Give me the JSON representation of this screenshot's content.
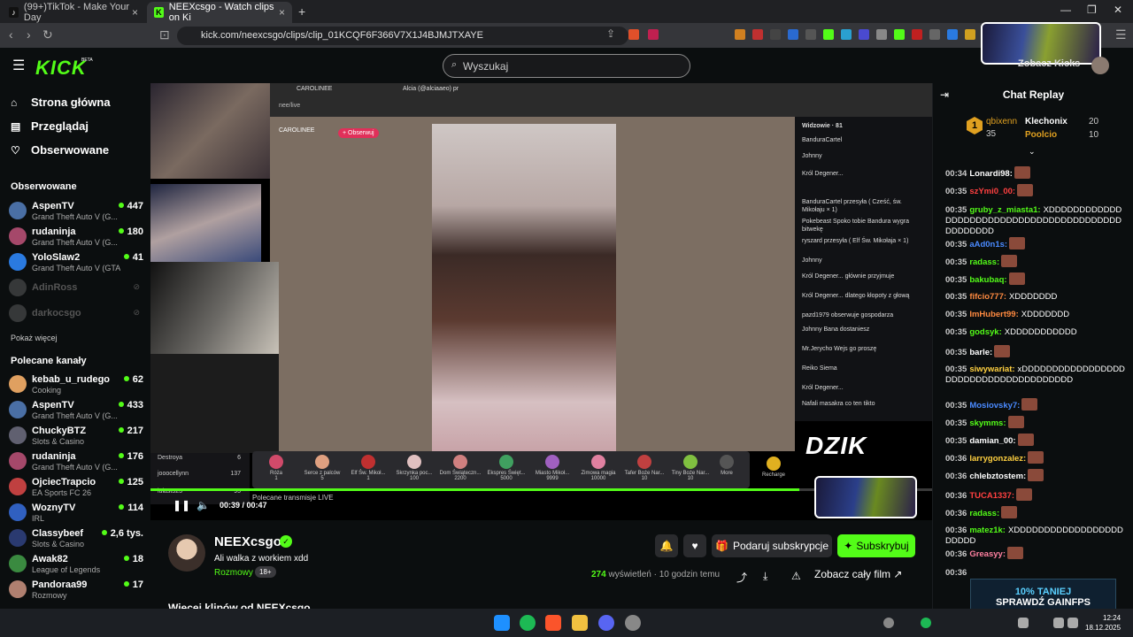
{
  "browser": {
    "tabs": [
      {
        "title": "(99+)TikTok - Make Your Day",
        "active": false
      },
      {
        "title": "NEEXcsgo - Watch clips on Ki",
        "active": true
      }
    ],
    "new_tab": "+",
    "url": "kick.com/neexcsgo/clips/clip_01KCQF6F366V7X1J4BJMJTXAYE"
  },
  "site": {
    "logo": "KICK",
    "logo_badge": "BETA",
    "search_placeholder": "Wyszukaj",
    "zobacz_label": "Zobacz Kicks"
  },
  "sidebar": {
    "nav": [
      {
        "label": "Strona główna",
        "icon": "home-icon"
      },
      {
        "label": "Przeglądaj",
        "icon": "browse-icon"
      },
      {
        "label": "Obserwowane",
        "icon": "heart-icon"
      }
    ],
    "followed_title": "Obserwowane",
    "followed": [
      {
        "name": "AspenTV",
        "game": "Grand Theft Auto V (G...",
        "viewers": "447",
        "color": "#4a6fa5",
        "live": true
      },
      {
        "name": "rudaninja",
        "game": "Grand Theft Auto V (G...",
        "viewers": "180",
        "color": "#a5486a",
        "live": true
      },
      {
        "name": "YoloSlaw2",
        "game": "Grand Theft Auto V (GTA)",
        "viewers": "41",
        "color": "#2a7ae0",
        "live": true
      },
      {
        "name": "AdinRoss",
        "game": "",
        "viewers": "",
        "color": "#777",
        "live": false
      },
      {
        "name": "darkocsgo",
        "game": "",
        "viewers": "",
        "color": "#777",
        "live": false
      }
    ],
    "show_more": "Pokaż więcej",
    "recommended_title": "Polecane kanały",
    "recommended": [
      {
        "name": "kebab_u_rudego",
        "game": "Cooking",
        "viewers": "62",
        "color": "#e0a060"
      },
      {
        "name": "AspenTV",
        "game": "Grand Theft Auto V (G...",
        "viewers": "433",
        "color": "#4a6fa5"
      },
      {
        "name": "ChuckyBTZ",
        "game": "Slots & Casino",
        "viewers": "217",
        "color": "#606070"
      },
      {
        "name": "rudaninja",
        "game": "Grand Theft Auto V (G...",
        "viewers": "176",
        "color": "#a5486a"
      },
      {
        "name": "OjciecTrapcio",
        "game": "EA Sports FC 26",
        "viewers": "125",
        "color": "#c04040"
      },
      {
        "name": "WoznyTV",
        "game": "IRL",
        "viewers": "114",
        "color": "#3060c0"
      },
      {
        "name": "Classybeef",
        "game": "Slots & Casino",
        "viewers": "2,6 tys.",
        "color": "#2a3a70"
      },
      {
        "name": "Awak82",
        "game": "League of Legends",
        "viewers": "18",
        "color": "#3a8a40"
      },
      {
        "name": "Pandoraa99",
        "game": "Rozmowy",
        "viewers": "17",
        "color": "#b08070"
      }
    ]
  },
  "player": {
    "inner_tab_1": "CAROLINEE",
    "inner_tab_2": "Alcia (@alciaaeo) pr",
    "inner_url": "nee/live",
    "stream_owner": "CAROLINEE",
    "follow_label": "+ Obserwuj",
    "viewers_header": "Widzowie · 81",
    "inner_chat": [
      "BanduraCartel",
      "Johnny",
      "Król Degener...",
      "BanduraCartel przesyła ( Cześć, św. Mikołaju × 1)",
      "Pokebeast Spoko tobie Bandura wygra bitwekę",
      "ryszard przesyła ( Elf Św. Mikołaja × 1)",
      "Johnny",
      "Król Degener... głównie przyjmuje",
      "Król Degener... dlatego kłopoty z głową",
      "pazd1979 obserwuje gospodarza",
      "Johnny Bana dostaniesz",
      "Mr.Jerycho Wejs go proszę",
      "Reiko Siema",
      "Król Degener...",
      "Nafali masakra co ten tikto"
    ],
    "gifts": [
      {
        "name": "Róża",
        "cost": "1"
      },
      {
        "name": "Serce z palców",
        "cost": "5"
      },
      {
        "name": "Elf Św. Mikoł...",
        "cost": "1"
      },
      {
        "name": "Skrzynka poc...",
        "cost": "100"
      },
      {
        "name": "Dom Świąteczn...",
        "cost": "2200"
      },
      {
        "name": "Ekspres Święt...",
        "cost": "5000"
      },
      {
        "name": "Miasto Mikoł...",
        "cost": "9999"
      },
      {
        "name": "Zimowa magia",
        "cost": "10000"
      },
      {
        "name": "Tafer Boże Nar...",
        "cost": "10"
      },
      {
        "name": "Tiny Boże Nar...",
        "cost": "10"
      },
      {
        "name": "More",
        "cost": ""
      },
      {
        "name": "Recharge",
        "cost": ""
      }
    ],
    "dzik_logo": "DZIK",
    "small_chat": [
      {
        "name": "Destroya",
        "count": "6"
      },
      {
        "name": "jooocellynn",
        "count": "137"
      },
      {
        "name": "lulast323",
        "count": "95"
      }
    ],
    "recommended_live": "Polecane transmisje LIVE",
    "current_time": "00:39",
    "duration": "00:47",
    "progress": 0.83
  },
  "clip": {
    "channel": "NEEXcsgo",
    "title": "Ali walka z workiem xdd",
    "category": "Rozmowy",
    "age": "18+",
    "gift_sub_label": "Podaruj subskrypcje",
    "subscribe_label": "Subskrybuj",
    "views": "274",
    "views_label": "wyświetleń",
    "time_ago": "· 10 godzin temu",
    "full_label": "Zobacz cały film",
    "more_clips": "Więcej klipów od NEEXcsgo"
  },
  "chat": {
    "title": "Chat Replay",
    "top_gifters": [
      {
        "rank": "1",
        "name": "qbixenn",
        "count": "35"
      },
      {
        "name": "Klechonix",
        "count": "20"
      },
      {
        "name": "Poolcio",
        "count": "10"
      }
    ],
    "messages": [
      {
        "time": "00:34",
        "user": "Lonardi98:",
        "color": "#ffffff",
        "text": "",
        "emote": true
      },
      {
        "time": "00:35",
        "user": "szYmi0_00:",
        "color": "#ff4040",
        "text": "",
        "emote": true
      },
      {
        "time": "00:35",
        "user": "gruby_z_miasta1:",
        "color": "#53fc18",
        "text": "XDDDDDDDDDDDDDDDDDDDDDDDDDDDDDDDDDDDDDDDDDDDDDDDDD",
        "emote": false
      },
      {
        "time": "00:35",
        "user": "aAd0n1s:",
        "color": "#4a8aff",
        "text": "",
        "emote": true
      },
      {
        "time": "00:35",
        "user": "radass:",
        "color": "#53fc18",
        "text": "",
        "emote": true
      },
      {
        "time": "00:35",
        "user": "bakubaq:",
        "color": "#53fc18",
        "text": "",
        "emote": true
      },
      {
        "time": "00:35",
        "user": "fifcio777:",
        "color": "#ff8a40",
        "text": "XDDDDDDD",
        "emote": false
      },
      {
        "time": "00:35",
        "user": "ImHubert99:",
        "color": "#ff8a40",
        "text": "XDDDDDDD",
        "emote": false
      },
      {
        "time": "00:35",
        "user": "godsyk:",
        "color": "#53fc18",
        "text": "XDDDDDDDDDDD",
        "emote": false
      },
      {
        "time": "00:35",
        "user": "barle:",
        "color": "#ffffff",
        "text": "",
        "emote": true
      },
      {
        "time": "00:35",
        "user": "siwywariat:",
        "color": "#ffd040",
        "text": "xDDDDDDDDDDDDDDDDDDDDDDDDDDDDDDDDDDDDDD",
        "emote": false
      },
      {
        "time": "00:35",
        "user": "Mosiovsky7:",
        "color": "#4a8aff",
        "text": "",
        "emote": true
      },
      {
        "time": "00:35",
        "user": "skymms:",
        "color": "#53fc18",
        "text": "",
        "emote": true
      },
      {
        "time": "00:35",
        "user": "damian_00:",
        "color": "#ffffff",
        "text": "",
        "emote": true
      },
      {
        "time": "00:36",
        "user": "larrygonzalez:",
        "color": "#ffd040",
        "text": "",
        "emote": true
      },
      {
        "time": "00:36",
        "user": "chlebztostem:",
        "color": "#ffffff",
        "text": "",
        "emote": true
      },
      {
        "time": "00:36",
        "user": "TUCA1337:",
        "color": "#ff4040",
        "text": "",
        "emote": true
      },
      {
        "time": "00:36",
        "user": "radass:",
        "color": "#53fc18",
        "text": "",
        "emote": true
      },
      {
        "time": "00:36",
        "user": "matez1k:",
        "color": "#53fc18",
        "text": "XDDDDDDDDDDDDDDDDDDDDDDD",
        "emote": false
      },
      {
        "time": "00:36",
        "user": "Greasyy:",
        "color": "#ff80a0",
        "text": "",
        "emote": true
      },
      {
        "time": "00:36",
        "user": "",
        "color": "#ffffff",
        "text": "",
        "emote": false
      }
    ],
    "ad_line1": "10% TANIEJ",
    "ad_line2": "SPRAWDŹ GAINFPS"
  },
  "taskbar": {
    "time": "12:24",
    "date": "18.12.2025"
  }
}
